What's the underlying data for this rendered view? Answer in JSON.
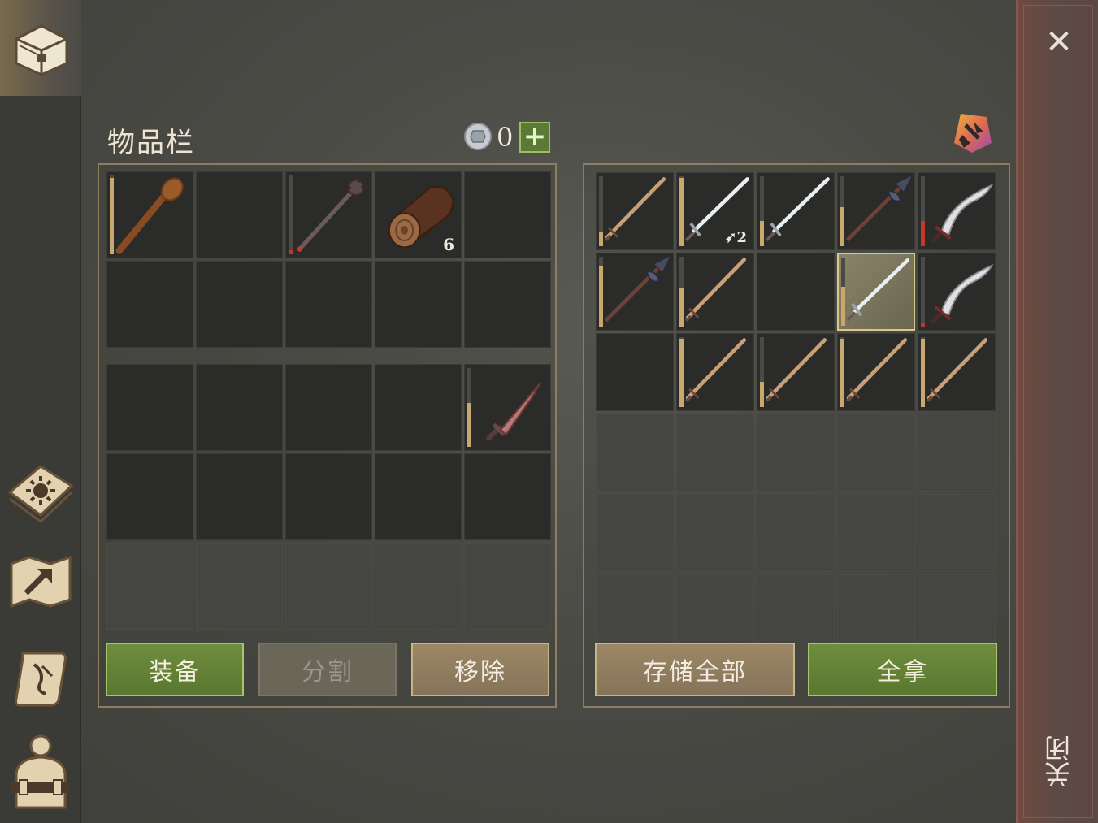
{
  "inventory": {
    "title": "物品栏",
    "coin_count": "0",
    "plus_label": "+",
    "upper_slots": [
      {
        "item": "club-icon",
        "durability": 0.95
      },
      null,
      {
        "item": "mace-icon",
        "durability": 0.05
      },
      {
        "item": "log-icon",
        "quantity": "6"
      },
      null,
      null,
      null,
      null,
      null,
      null
    ],
    "lower_slots": [
      null,
      null,
      null,
      null,
      {
        "item": "dagger-icon",
        "durability": 0.55
      },
      null,
      null,
      null,
      null,
      null,
      null,
      null,
      null,
      null,
      null
    ],
    "buttons": {
      "equip": "装备",
      "split": "分割",
      "remove": "移除"
    }
  },
  "storage": {
    "slots": [
      {
        "item": "wooden-sword-icon",
        "durability": 0.2
      },
      {
        "item": "steel-sword-icon",
        "durability": 0.95,
        "badge": "2"
      },
      {
        "item": "steel-sword-icon",
        "durability": 0.35
      },
      {
        "item": "halberd-icon",
        "durability": 0.55
      },
      {
        "item": "scimitar-icon",
        "durability": 0.35,
        "red": true
      },
      {
        "item": "halberd-icon",
        "durability": 0.85
      },
      {
        "item": "wooden-sword-icon",
        "durability": 0.55
      },
      null,
      {
        "item": "steel-sword-icon",
        "durability": 0.55,
        "selected": true
      },
      {
        "item": "scimitar-icon",
        "durability": 0.05,
        "red": true
      },
      null,
      {
        "item": "wooden-sword-icon",
        "durability": 0.95
      },
      {
        "item": "wooden-sword-icon",
        "durability": 0.35
      },
      {
        "item": "wooden-sword-icon",
        "durability": 0.95
      },
      {
        "item": "wooden-sword-icon",
        "durability": 0.95
      }
    ],
    "empty_rows": 3,
    "buttons": {
      "store_all": "存储全部",
      "take_all": "全拿"
    }
  },
  "sidebar": {
    "items": [
      "chest-icon",
      "crafting-book-icon",
      "map-icon",
      "quest-scroll-icon",
      "character-icon"
    ]
  },
  "close": {
    "x_glyph": "✕",
    "label": "关闭"
  },
  "colors": {
    "accent_green": "#6f8d3e",
    "accent_tan": "#9c8866",
    "durability": "#c9a870",
    "durability_low": "#c0392b"
  }
}
